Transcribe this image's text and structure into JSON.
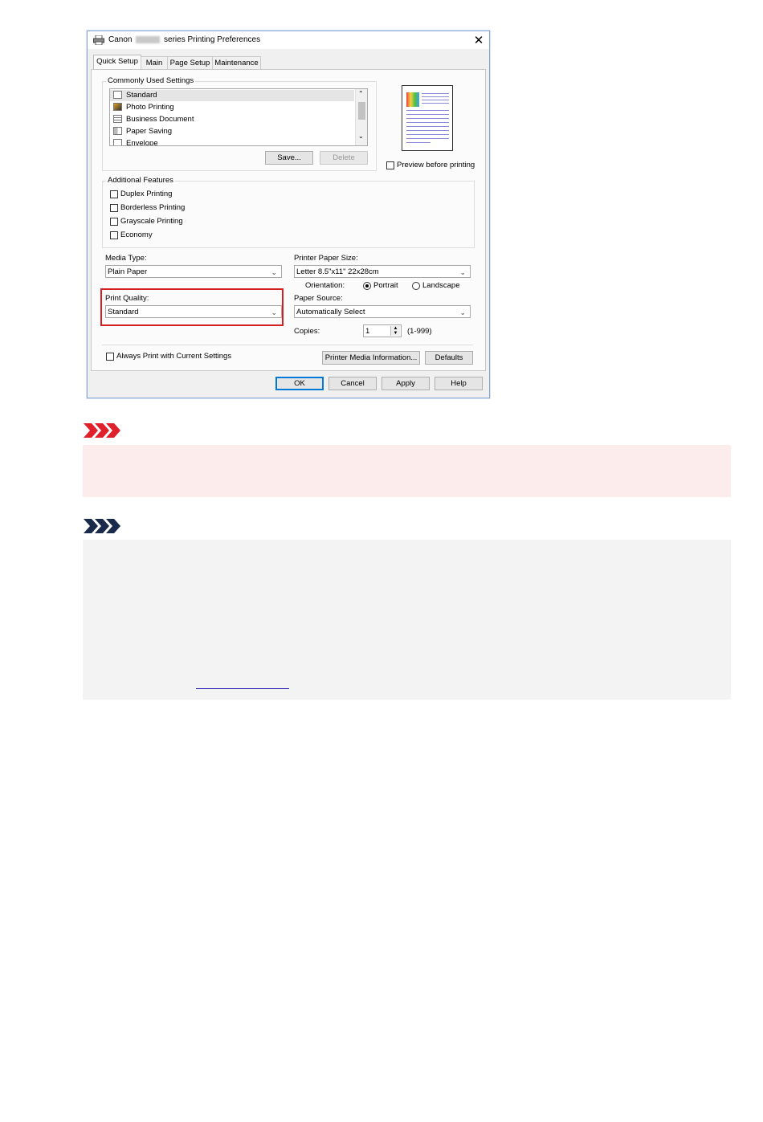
{
  "dialog": {
    "title_prefix": "Canon",
    "title_suffix": "series Printing Preferences",
    "close": "✕",
    "tabs": [
      {
        "label": "Quick Setup",
        "active": true
      },
      {
        "label": "Main",
        "active": false
      },
      {
        "label": "Page Setup",
        "active": false
      },
      {
        "label": "Maintenance",
        "active": false
      }
    ],
    "commonly_used": {
      "label": "Commonly Used Settings",
      "items": [
        "Standard",
        "Photo Printing",
        "Business Document",
        "Paper Saving",
        "Envelope"
      ],
      "selected": "Standard",
      "save": "Save...",
      "delete": "Delete"
    },
    "preview_before_printing": "Preview before printing",
    "additional_features": {
      "label": "Additional Features",
      "items": [
        "Duplex Printing",
        "Borderless Printing",
        "Grayscale Printing",
        "Economy"
      ]
    },
    "media_type": {
      "label": "Media Type:",
      "value": "Plain Paper"
    },
    "printer_paper_size": {
      "label": "Printer Paper Size:",
      "value": "Letter 8.5\"x11\" 22x28cm"
    },
    "orientation": {
      "label": "Orientation:",
      "portrait": "Portrait",
      "landscape": "Landscape",
      "selected": "Portrait"
    },
    "print_quality": {
      "label": "Print Quality:",
      "value": "Standard"
    },
    "paper_source": {
      "label": "Paper Source:",
      "value": "Automatically Select"
    },
    "copies": {
      "label": "Copies:",
      "value": "1",
      "range": "(1-999)"
    },
    "always_print": "Always Print with Current Settings",
    "printer_media_info": "Printer Media Information...",
    "defaults": "Defaults",
    "ok": "OK",
    "cancel": "Cancel",
    "apply": "Apply",
    "help": "Help"
  },
  "colors": {
    "important_bg": "#fdecec",
    "important_icon": "#e0202a",
    "note_bg": "#f3f3f3",
    "note_icon": "#1a2a4a",
    "highlight_border": "#d42020",
    "link": "#1a0dab"
  }
}
